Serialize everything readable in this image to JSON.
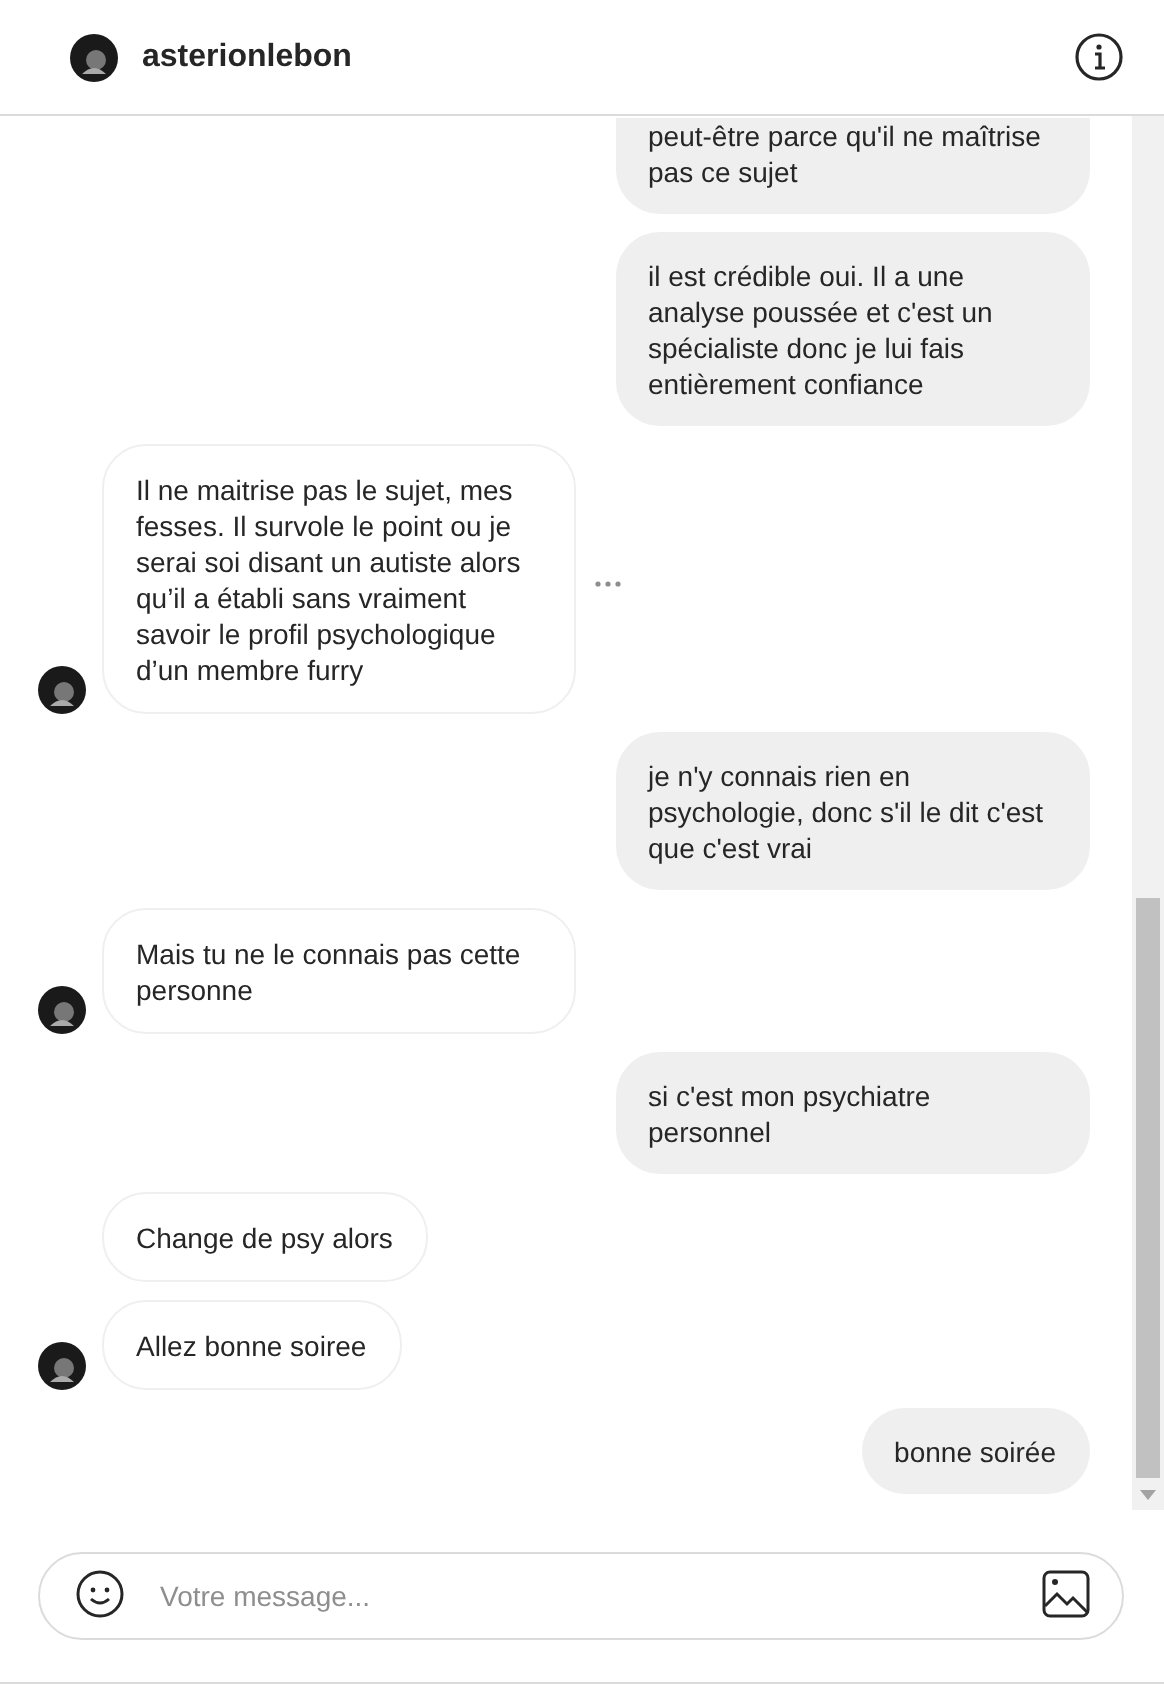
{
  "header": {
    "username": "asterionlebon"
  },
  "messages": [
    {
      "kind": "sent",
      "clipped": true,
      "text": "peut-être parce qu'il ne maîtrise pas ce sujet"
    },
    {
      "kind": "sent",
      "clipped": false,
      "text": "il est crédible oui. Il a une analyse poussée et c'est un spécialiste donc je lui fais entièrement confiance"
    },
    {
      "kind": "received",
      "avatar": true,
      "more_menu": true,
      "text": "Il ne maitrise pas le sujet, mes fesses. Il survole le point ou je serai soi disant un autiste alors qu’il a établi sans vraiment savoir le profil psychologique d’un membre furry"
    },
    {
      "kind": "sent",
      "clipped": false,
      "text": "je n'y connais rien en psychologie, donc s'il le dit c'est que c'est vrai"
    },
    {
      "kind": "received",
      "avatar": true,
      "more_menu": false,
      "text": "Mais tu ne le connais pas cette personne"
    },
    {
      "kind": "sent",
      "clipped": false,
      "text": "si c'est mon psychiatre personnel"
    },
    {
      "kind": "received",
      "avatar": false,
      "more_menu": false,
      "text": "Change de psy alors"
    },
    {
      "kind": "received",
      "avatar": true,
      "more_menu": false,
      "text": "Allez bonne soiree"
    },
    {
      "kind": "sent",
      "clipped": false,
      "text": "bonne soirée"
    }
  ],
  "composer": {
    "placeholder": "Votre message..."
  }
}
